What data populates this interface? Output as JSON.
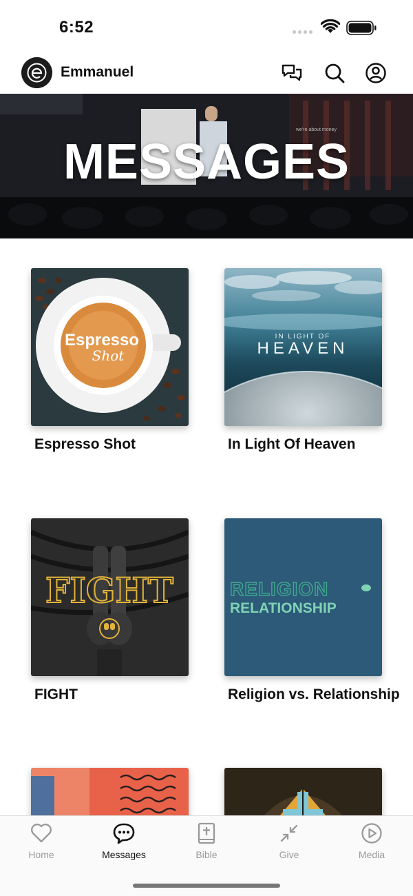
{
  "status_bar": {
    "time": "6:52"
  },
  "header": {
    "app_name": "Emmanuel"
  },
  "hero": {
    "title": "MESSAGES",
    "banner_text": "we're about money"
  },
  "series": [
    {
      "title": "Espresso Shot",
      "art_text": "Espresso",
      "art_script": "Shot"
    },
    {
      "title": "In Light Of Heaven",
      "art_small": "IN LIGHT OF",
      "art_big": "HEAVEN"
    },
    {
      "title": "FIGHT",
      "art_text": "FIGHT"
    },
    {
      "title": "Religion vs. Relationship",
      "art_line1": "RELIGION",
      "art_line2": "RELATIONSHIP"
    },
    {
      "title": ""
    },
    {
      "title": ""
    }
  ],
  "tabs": [
    {
      "label": "Home",
      "icon": "heart-icon"
    },
    {
      "label": "Messages",
      "icon": "chat-bubble-icon"
    },
    {
      "label": "Bible",
      "icon": "bible-icon"
    },
    {
      "label": "Give",
      "icon": "give-icon"
    },
    {
      "label": "Media",
      "icon": "play-circle-icon"
    }
  ],
  "colors": {
    "active_tab": "#111111",
    "inactive_tab": "#999999",
    "religion_bg": "#2c5a78",
    "fight_accent": "#e2b33a"
  }
}
